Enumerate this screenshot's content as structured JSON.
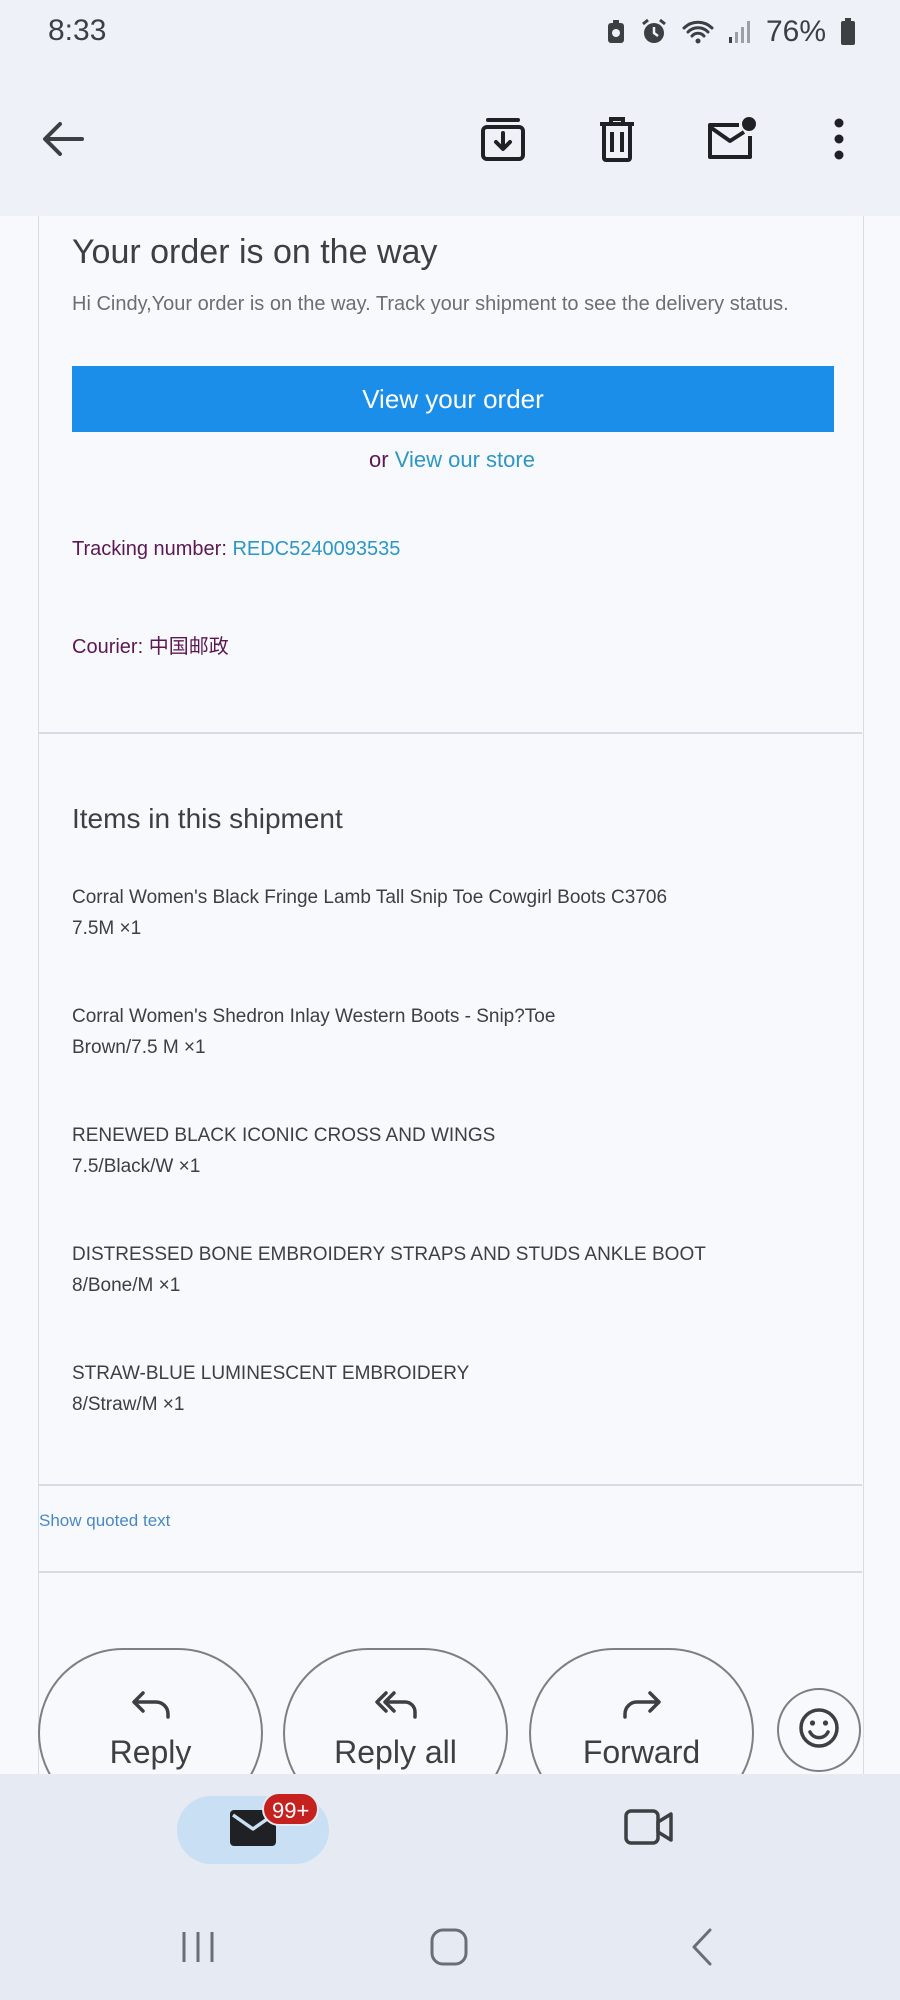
{
  "status_bar": {
    "time": "8:33",
    "battery": "76%"
  },
  "app_bar": {
    "back_icon": "arrow-back-icon",
    "archive_icon": "archive-icon",
    "delete_icon": "trash-icon",
    "unread_icon": "mark-unread-icon",
    "more_icon": "more-vert-icon"
  },
  "email": {
    "heading": "Your order is on the way",
    "greeting": "Hi Cindy,Your order is on the way. Track your shipment to see the delivery status.",
    "view_order_label": "View your order",
    "or_text": "or",
    "view_store_label": "View our store",
    "tracking_label": "Tracking number:",
    "tracking_number": "REDC5240093535",
    "courier_label": "Courier:",
    "courier_value": "中国邮政",
    "items_title": "Items in this shipment",
    "items": [
      {
        "name": "Corral Women's Black Fringe Lamb Tall Snip Toe Cowgirl Boots C3706",
        "variant": "7.5M ×1"
      },
      {
        "name": "Corral Women's Shedron Inlay Western Boots - Snip?Toe",
        "variant": "Brown/7.5 M ×1"
      },
      {
        "name": "RENEWED BLACK ICONIC CROSS AND WINGS",
        "variant": "7.5/Black/W ×1"
      },
      {
        "name": "DISTRESSED BONE EMBROIDERY STRAPS AND STUDS ANKLE BOOT",
        "variant": "8/Bone/M ×1"
      },
      {
        "name": "STRAW-BLUE LUMINESCENT EMBROIDERY",
        "variant": "8/Straw/M ×1"
      }
    ],
    "show_quoted": "Show quoted text"
  },
  "actions": {
    "reply": "Reply",
    "reply_all": "Reply all",
    "forward": "Forward"
  },
  "bottom_nav": {
    "mail_badge": "99+"
  },
  "colors": {
    "accent": "#1a8ee8",
    "link": "#2c97c4",
    "label": "#5c1853",
    "badge": "#c5221f"
  }
}
